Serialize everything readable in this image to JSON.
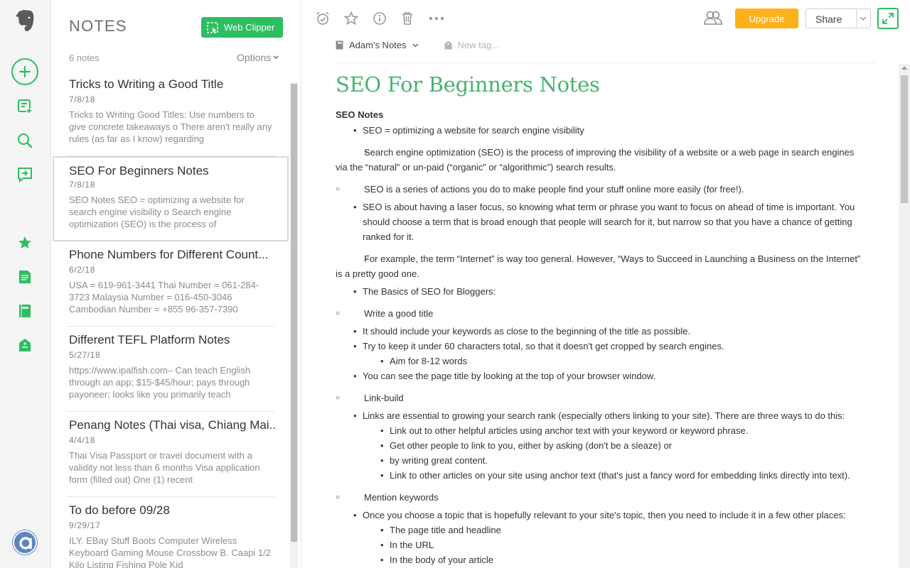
{
  "colors": {
    "accent": "#2dbe60",
    "upgrade": "#fcb11b",
    "title": "#45b56e"
  },
  "rail": {
    "icons": [
      "elephant-logo-icon",
      "new-note-icon",
      "new-chat-icon",
      "search-icon",
      "work-chat-icon",
      "shortcuts-star-icon",
      "notes-icon",
      "notebooks-icon",
      "tags-icon",
      "account-avatar-icon"
    ]
  },
  "list": {
    "title": "NOTES",
    "web_clipper": "Web Clipper",
    "count": "6 notes",
    "options": "Options",
    "notes": [
      {
        "title": "Tricks to Writing a Good Title",
        "date": "7/8/18",
        "preview": "Tricks to Writing Good Titles: Use numbers to give concrete takeaways o There aren't really any rules (as far as I know) regarding"
      },
      {
        "title": "SEO For Beginners Notes",
        "date": "7/8/18",
        "preview": "SEO Notes SEO = optimizing a website for search engine visibility o Search engine optimization (SEO) is the process of"
      },
      {
        "title": "Phone Numbers for Different Count...",
        "date": "6/2/18",
        "preview": "USA = 619-961-3441 Thai Number = 061-284-3723 Malaysia Number = 016-450-3046 Cambodian Number = +855 96-357-7390"
      },
      {
        "title": "Different TEFL Platform Notes",
        "date": "5/27/18",
        "preview": "https://www.ipalfish.com– Can teach English through an app; $15-$45/hour; pays through payoneer; looks like you primarily teach"
      },
      {
        "title": "Penang Notes (Thai visa, Chiang Mai...",
        "date": "4/4/18",
        "preview": "Thai Visa Passport or travel document with a validity not less than 6 months Visa application form (filled out) One (1) recent"
      },
      {
        "title": "To do before 09/28",
        "date": "9/29/17",
        "preview": "ILY. EBay Stuff Boots Computer Wireless Keyboard Gaming Mouse Crossbow B. Caapi 1/2 Kilo Listing Fishing Pole Kid"
      }
    ]
  },
  "toolbar": {
    "upgrade": "Upgrade",
    "share": "Share"
  },
  "meta": {
    "notebook": "Adam's Notes",
    "tag_placeholder": "New tag..."
  },
  "doc": {
    "title": "SEO For Beginners Notes",
    "heading": "SEO Notes",
    "l1": "SEO = optimizing a website for search engine visibility",
    "l2": "Search engine optimization (SEO) is the process of improving the visibility of a website or a web page in search engines via the “natural” or un-paid (“organic” or “algorithmic”) search results.",
    "l3": "SEO is a series of actions you do to make people find your stuff online more easily (for free!).",
    "l4": "SEO is about having a laser focus, so knowing what term or phrase you want to focus on ahead of time is important. You should choose a term that is broad enough that people will search for it, but narrow so that you have a chance of getting ranked for it.",
    "l5": "For example, the term “Internet” is way too general. However, “Ways to Succeed in Launching a Business on the Internet” is a pretty good one.",
    "l6": "The Basics of SEO for Bloggers:",
    "l7": "Write a good title",
    "l8": "It should include your keywords as close to the beginning of the title as possible.",
    "l9": "Try to keep it under 60 characters total, so that it doesn't get cropped by search engines.",
    "l10": "Aim for 8-12 words",
    "l11": "You can see the page title by looking at the top of your browser window.",
    "l12": "Link-build",
    "l13": "Links are essential to growing your search rank (especially others linking to your site). There are three ways to do this:",
    "l14": "Link out to other helpful articles using anchor text with your keyword or keyword phrase.",
    "l15": "Get other people to link to you, either by asking (don't be a sleaze) or",
    "l16": "by writing great content.",
    "l17": "Link to other articles on your site using anchor text (that's just a fancy word for embedding links directly into text).",
    "l18": "Mention keywords",
    "l19": "Once you choose a topic that is hopefully relevant to your site's topic, then you need to include it in a few other places:",
    "l20": "The page title and headline",
    "l21": "In the URL",
    "l22": "In the body of your article"
  }
}
